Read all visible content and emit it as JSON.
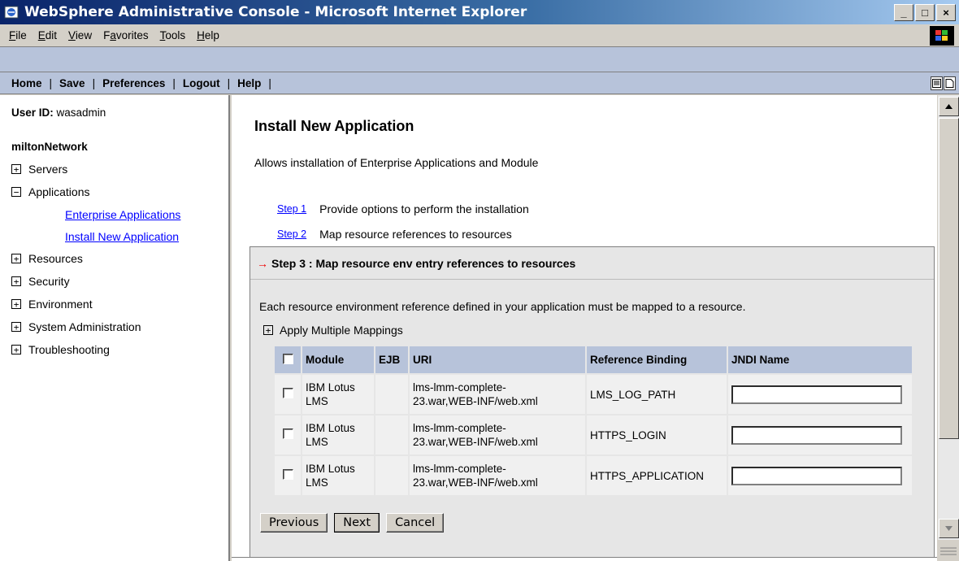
{
  "window": {
    "title": "WebSphere Administrative Console - Microsoft Internet Explorer",
    "minimize": "_",
    "maximize": "□",
    "close": "×"
  },
  "menubar": {
    "items": [
      {
        "pre": "",
        "key": "F",
        "post": "ile"
      },
      {
        "pre": "",
        "key": "E",
        "post": "dit"
      },
      {
        "pre": "",
        "key": "V",
        "post": "iew"
      },
      {
        "pre": "F",
        "key": "a",
        "post": "vorites"
      },
      {
        "pre": "",
        "key": "T",
        "post": "ools"
      },
      {
        "pre": "",
        "key": "H",
        "post": "elp"
      }
    ]
  },
  "topnav": {
    "home": "Home",
    "save": "Save",
    "preferences": "Preferences",
    "logout": "Logout",
    "help": "Help",
    "sep": "|"
  },
  "leftnav": {
    "user_label": "User ID:",
    "user_value": "wasadmin",
    "cell": "miltonNetwork",
    "items": {
      "servers": "Servers",
      "applications": "Applications",
      "enterprise_apps": "Enterprise Applications",
      "install_new": "Install New Application",
      "resources": "Resources",
      "security": "Security",
      "environment": "Environment",
      "sysadmin": "System Administration",
      "troubleshooting": "Troubleshooting"
    },
    "expand_symbol": "+",
    "collapse_symbol": "−"
  },
  "main": {
    "title": "Install New Application",
    "description": "Allows installation of Enterprise Applications and Module",
    "step1_link": "Step 1",
    "step1_text": "Provide options to perform the installation",
    "step2_link": "Step 2",
    "step2_text": "Map resource references to resources",
    "step3_arrow": "→",
    "step3_title": "Step 3 :  Map resource env entry references to resources",
    "step3_desc": "Each resource environment reference defined in your application must be mapped to a resource.",
    "multi_map": "Apply Multiple Mappings",
    "table": {
      "headers": {
        "module": "Module",
        "ejb": "EJB",
        "uri": "URI",
        "ref": "Reference Binding",
        "jndi": "JNDI Name"
      },
      "rows": [
        {
          "module_line1": "IBM Lotus",
          "module_line2": "LMS",
          "ejb": "",
          "uri_line1": "lms-lmm-complete-",
          "uri_line2": "23.war,WEB-INF/web.xml",
          "ref": "LMS_LOG_PATH",
          "jndi": ""
        },
        {
          "module_line1": "IBM Lotus",
          "module_line2": "LMS",
          "ejb": "",
          "uri_line1": "lms-lmm-complete-",
          "uri_line2": "23.war,WEB-INF/web.xml",
          "ref": "HTTPS_LOGIN",
          "jndi": ""
        },
        {
          "module_line1": "IBM Lotus",
          "module_line2": "LMS",
          "ejb": "",
          "uri_line1": "lms-lmm-complete-",
          "uri_line2": "23.war,WEB-INF/web.xml",
          "ref": "HTTPS_APPLICATION",
          "jndi": ""
        }
      ]
    },
    "buttons": {
      "previous": "Previous",
      "next": "Next",
      "cancel": "Cancel"
    }
  }
}
